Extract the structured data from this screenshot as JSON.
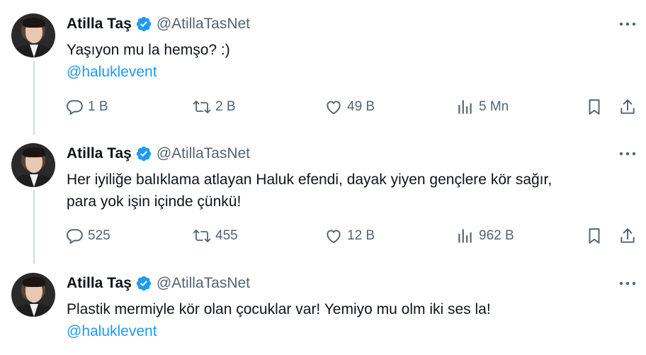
{
  "tweets": [
    {
      "author_name": "Atilla Taş",
      "author_handle": "@AtillaTasNet",
      "text": "Yaşıyon mu la hemşo? :)",
      "mention": "@haluklevent",
      "replies": "1 B",
      "retweets": "2 B",
      "likes": "49 B",
      "views": "5 Mn"
    },
    {
      "author_name": "Atilla Taş",
      "author_handle": "@AtillaTasNet",
      "text_line1": "Her iyiliğe balıklama atlayan Haluk efendi, dayak yiyen gençlere kör sağır,",
      "text_line2": "para yok işin içinde çünkü!",
      "replies": "525",
      "retweets": "455",
      "likes": "12 B",
      "views": "962 B"
    },
    {
      "author_name": "Atilla Taş",
      "author_handle": "@AtillaTasNet",
      "text": "Plastik mermiyle kör olan çocuklar var! Yemiyo mu olm iki ses la!",
      "mention": "@haluklevent"
    }
  ],
  "icons": {
    "verified": "verified-badge-icon",
    "more": "more-options-icon",
    "reply": "reply-icon",
    "retweet": "retweet-icon",
    "like": "heart-icon",
    "views": "views-icon",
    "bookmark": "bookmark-icon",
    "share": "share-icon"
  },
  "colors": {
    "verified": "#1d9bf0",
    "mention": "#1d9bf0",
    "secondary_text": "#536471",
    "thread_line": "#cfd9de"
  }
}
